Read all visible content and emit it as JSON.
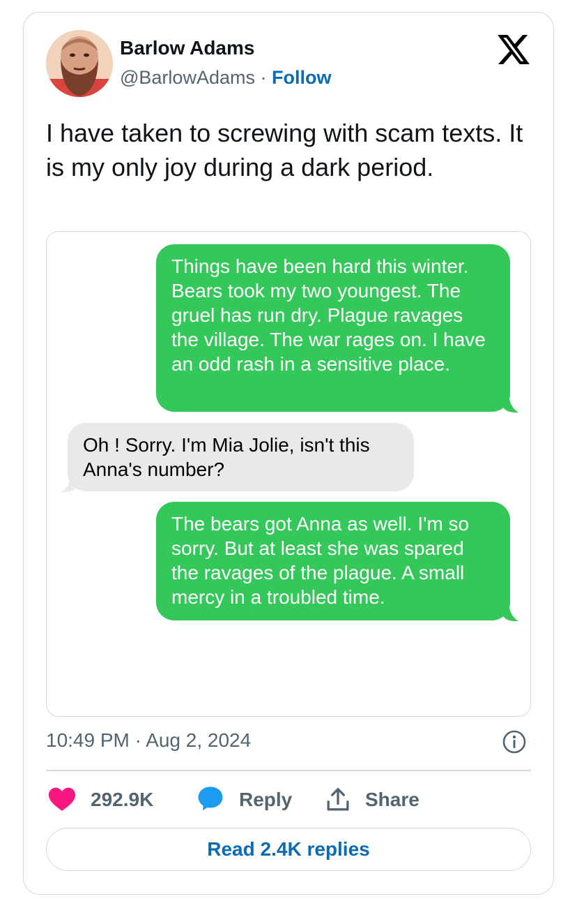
{
  "author": {
    "name": "Barlow Adams",
    "handle": "@BarlowAdams",
    "separator": " · ",
    "follow_label": "Follow"
  },
  "tweet": {
    "text": "I have taken to screwing with scam texts. It is my only joy during a dark period."
  },
  "messages": [
    {
      "direction": "outgoing",
      "text": "Things have been hard this winter. Bears took my two youngest. The gruel has run dry. Plague ravages the village. The war rages on. I have an odd rash in a sensitive place."
    },
    {
      "direction": "incoming",
      "text": "Oh ! Sorry. I'm Mia Jolie, isn't this Anna's number?"
    },
    {
      "direction": "outgoing",
      "text": "The bears got Anna as well. I'm so sorry. But at least she was spared the ravages of the plague. A small mercy in a troubled time."
    }
  ],
  "timestamp": "10:49 PM · Aug 2, 2024",
  "actions": {
    "like_count": "292.9K",
    "reply_label": "Reply",
    "share_label": "Share"
  },
  "read_replies_label": "Read 2.4K replies",
  "colors": {
    "outgoing_bubble": "#34c759",
    "incoming_bubble": "#e9e9eb",
    "link": "#0a6bb5",
    "like_heart": "#f91880",
    "reply_bubble_icon": "#1d9bf0"
  },
  "icons": [
    "x-logo-icon",
    "info-icon",
    "heart-icon",
    "reply-icon",
    "share-icon"
  ]
}
